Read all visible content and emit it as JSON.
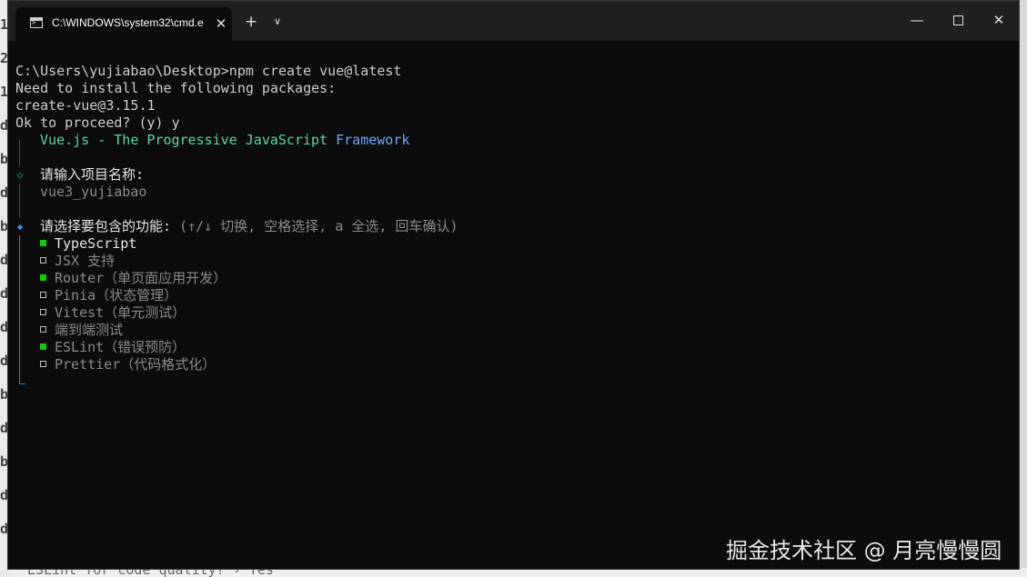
{
  "background_window": {
    "side_glyphs": [
      "1",
      "2",
      "1",
      "d",
      "b",
      "d",
      "b",
      "d",
      "d",
      "d",
      "d",
      "b",
      "d",
      "b",
      "d",
      "d"
    ],
    "bottom_text": "ESLint for code quality? › Yes"
  },
  "window": {
    "tab_title": "C:\\WINDOWS\\system32\\cmd.e",
    "tab_close": "✕",
    "new_tab": "+",
    "tab_dropdown": "∨",
    "minimize": "—",
    "close": "✕"
  },
  "terminal": {
    "cmd_line": "C:\\Users\\yujiabao\\Desktop>npm create vue@latest",
    "need_install": "Need to install the following packages:",
    "package": "create-vue@3.15.1",
    "proceed": "Ok to proceed? (y) y",
    "banner": {
      "vue": "Vue.js - The ",
      "progressive": "Progressive JavaScript ",
      "framework": "Framework"
    },
    "q1_glyph": "◇",
    "q1_label": "请输入项目名称:",
    "q1_answer": "vue3_yujiabao",
    "q2_glyph": "◆",
    "q2_label": "请选择要包含的功能:",
    "q2_hint": " (↑/↓ 切换, 空格选择, a 全选, 回车确认)",
    "options": [
      {
        "label": "TypeScript",
        "checked": true,
        "active": true
      },
      {
        "label": "JSX 支持",
        "checked": false,
        "active": false
      },
      {
        "label": "Router（单页面应用开发）",
        "checked": true,
        "active": false
      },
      {
        "label": "Pinia（状态管理）",
        "checked": false,
        "active": false
      },
      {
        "label": "Vitest（单元测试）",
        "checked": false,
        "active": false
      },
      {
        "label": "端到端测试",
        "checked": false,
        "active": false
      },
      {
        "label": "ESLint（错误预防）",
        "checked": true,
        "active": false
      },
      {
        "label": "Prettier（代码格式化）",
        "checked": false,
        "active": false
      }
    ]
  },
  "watermark": "掘金技术社区 @ 月亮慢慢圆",
  "colors": {
    "terminal_bg": "#0c0c0c",
    "titlebar_bg": "#202020",
    "checked_box": "#16c60c",
    "active_diamond": "#2d8be0",
    "done_diamond": "#15a34a"
  }
}
